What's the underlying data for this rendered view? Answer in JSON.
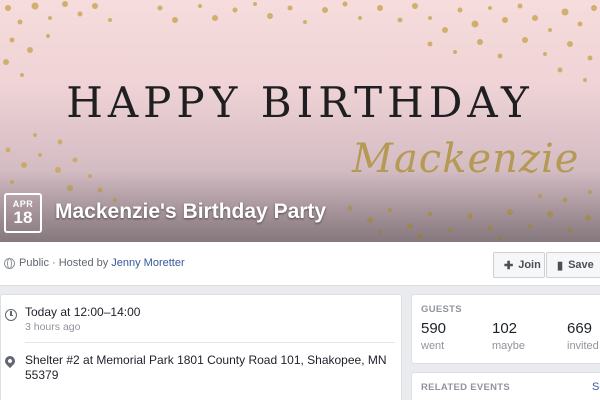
{
  "cover": {
    "title": "HAPPY BIRTHDAY",
    "script_name": "Mackenzie",
    "accent_gold": "#b49a55"
  },
  "event": {
    "date_month": "APR",
    "date_day": "18",
    "title": "Mackenzie's Birthday Party"
  },
  "host_bar": {
    "privacy": "Public · Hosted by",
    "host_name": "Jenny Moretter",
    "privacy_icon": "globe-icon",
    "join_label": "Join",
    "join_icon": "join-icon",
    "save_label": "Save",
    "save_icon": "bookmark-icon"
  },
  "details": {
    "time": "Today at 12:00–14:00",
    "time_sub": "3 hours ago",
    "time_icon": "clock-icon",
    "location": "Shelter #2 at Memorial Park 1801 County Road 101, Shakopee, MN 55379",
    "location_icon": "pin-icon"
  },
  "guests": {
    "heading": "GUESTS",
    "went_count": "590",
    "went_label": "went",
    "maybe_count": "102",
    "maybe_label": "maybe",
    "invited_count": "669",
    "invited_label": "invited"
  },
  "related": {
    "heading": "RELATED EVENTS",
    "see_all": "Se"
  },
  "colors": {
    "link": "#365899",
    "page_bg": "#e9ebee"
  }
}
